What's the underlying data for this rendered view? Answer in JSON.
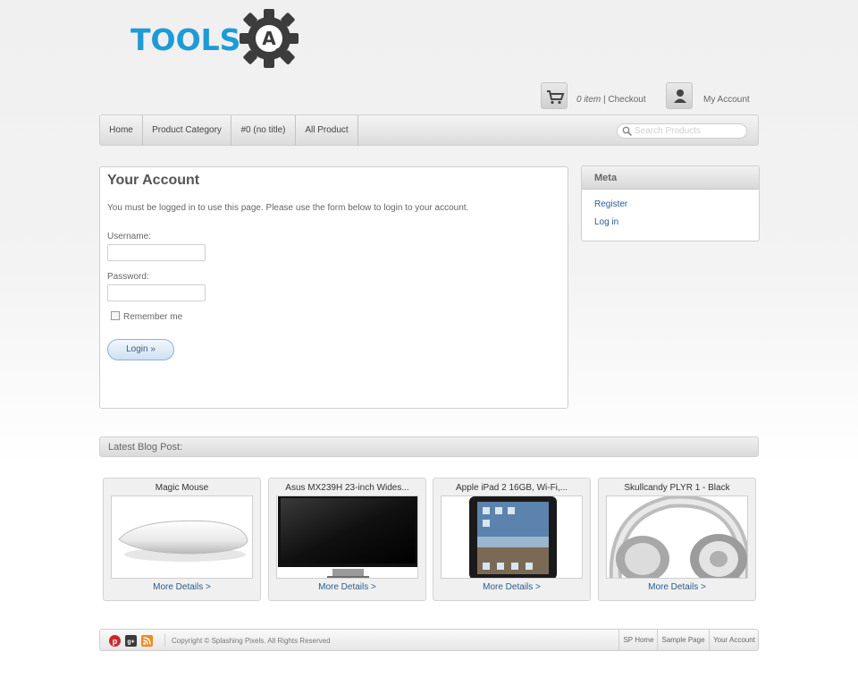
{
  "header": {
    "logo_text": "TOOLS",
    "logo_mark": "A",
    "cart_count": "0 item",
    "cart_sep": " | ",
    "checkout_label": "Checkout",
    "account_label": "My Account"
  },
  "nav": {
    "items": [
      {
        "label": "Home"
      },
      {
        "label": "Product Category"
      },
      {
        "label": "#0 (no title)"
      },
      {
        "label": "All Product"
      }
    ],
    "search_placeholder": "Search Products"
  },
  "account": {
    "title": "Your Account",
    "message": "You must be logged in to use this page. Please use the form below to login to your account.",
    "username_label": "Username:",
    "password_label": "Password:",
    "remember_label": "Remember me",
    "login_label": "Login »"
  },
  "meta": {
    "title": "Meta",
    "links": [
      {
        "label": "Register"
      },
      {
        "label": "Log in"
      }
    ]
  },
  "blog": {
    "heading": "Latest Blog Post:"
  },
  "products": [
    {
      "title": "Magic Mouse",
      "more": "More Details >"
    },
    {
      "title": "Asus MX239H 23-inch Wides...",
      "more": "More Details >"
    },
    {
      "title": "Apple iPad 2 16GB, Wi-Fi,...",
      "more": "More Details >"
    },
    {
      "title": "Skullcandy PLYR 1 - Black",
      "more": "More Details >"
    }
  ],
  "footer": {
    "copyright": "Copyright © Splashing Pixels. All Rights Reserved",
    "social_icons": [
      "pinterest-icon",
      "google-plus-icon",
      "rss-icon"
    ],
    "links": [
      {
        "label": "SP Home"
      },
      {
        "label": "Sample Page"
      },
      {
        "label": "Your Account"
      }
    ]
  },
  "colors": {
    "logo_blue": "#1e9bd7",
    "logo_gear": "#3c3c3c",
    "link_blue": "#2a5d8c"
  }
}
